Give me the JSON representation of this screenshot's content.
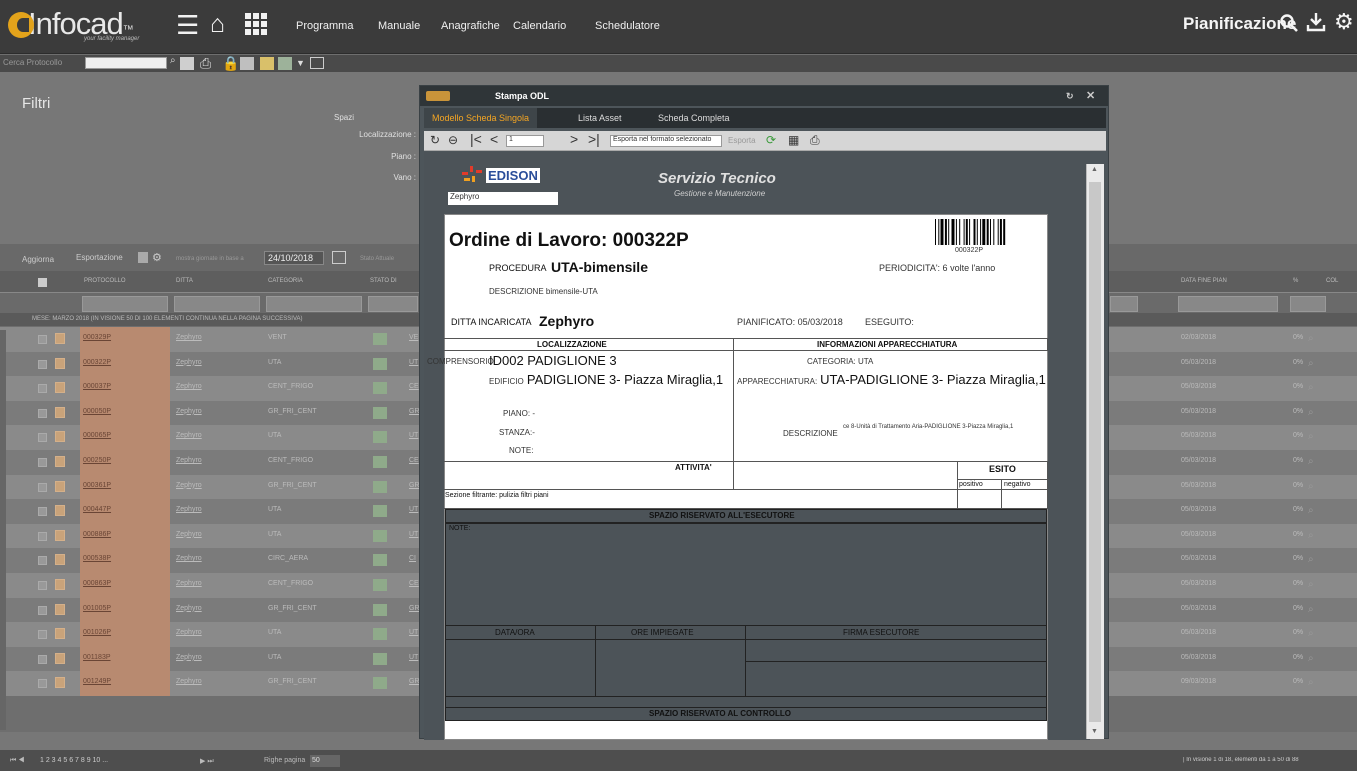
{
  "app": {
    "brand": "Infocad",
    "brand_mark": "™",
    "brand_sub": "your facility manager",
    "section": "Pianificazione"
  },
  "nav": [
    "Programma",
    "Manuale",
    "Anagrafiche",
    "Calendario",
    "Schedulatore"
  ],
  "bar2": {
    "label": "Cerca Protocollo",
    "placeholder": ""
  },
  "filters": {
    "title": "Filtri",
    "spazi": "Spazi",
    "labels": [
      "Localizzazione :",
      "Piano :",
      "Vano :"
    ]
  },
  "gridbar": {
    "aggiorna": "Aggiorna",
    "esportazione": "Esportazione",
    "date_label": "mostra giornate in base a",
    "date_value": "24/10/2018",
    "stato": "Stato Attuale"
  },
  "grid": {
    "headers": [
      "PROTOCOLLO",
      "DITTA",
      "CATEGORIA",
      "STATO DI",
      "DATA FINE PIAN",
      "%",
      "COL"
    ],
    "group": "MESE: MARZO 2018 (IN VISIONE 50 DI 100 ELEMENTI CONTINUA NELLA PAGINA SUCCESSIVA)"
  },
  "rows": [
    {
      "protocollo": "000329P",
      "ditta": "Zephyro",
      "categoria": "VENT",
      "code": "VE",
      "data": "02/03/2018",
      "pct": "0%"
    },
    {
      "protocollo": "000322P",
      "ditta": "Zephyro",
      "categoria": "UTA",
      "code": "UT",
      "data": "05/03/2018",
      "pct": "0%"
    },
    {
      "protocollo": "000037P",
      "ditta": "Zephyro",
      "categoria": "CENT_FRIGO",
      "code": "CE",
      "data": "05/03/2018",
      "pct": "0%"
    },
    {
      "protocollo": "000050P",
      "ditta": "Zephyro",
      "categoria": "GR_FRI_CENT",
      "code": "GR",
      "data": "05/03/2018",
      "pct": "0%"
    },
    {
      "protocollo": "000065P",
      "ditta": "Zephyro",
      "categoria": "UTA",
      "code": "UT",
      "data": "05/03/2018",
      "pct": "0%"
    },
    {
      "protocollo": "000250P",
      "ditta": "Zephyro",
      "categoria": "CENT_FRIGO",
      "code": "CE",
      "data": "05/03/2018",
      "pct": "0%"
    },
    {
      "protocollo": "000361P",
      "ditta": "Zephyro",
      "categoria": "GR_FRI_CENT",
      "code": "GR",
      "data": "05/03/2018",
      "pct": "0%"
    },
    {
      "protocollo": "000447P",
      "ditta": "Zephyro",
      "categoria": "UTA",
      "code": "UT",
      "data": "05/03/2018",
      "pct": "0%"
    },
    {
      "protocollo": "000886P",
      "ditta": "Zephyro",
      "categoria": "UTA",
      "code": "UT",
      "data": "05/03/2018",
      "pct": "0%"
    },
    {
      "protocollo": "000538P",
      "ditta": "Zephyro",
      "categoria": "CIRC_AERA",
      "code": "CI",
      "data": "05/03/2018",
      "pct": "0%"
    },
    {
      "protocollo": "000863P",
      "ditta": "Zephyro",
      "categoria": "CENT_FRIGO",
      "code": "CE",
      "data": "05/03/2018",
      "pct": "0%"
    },
    {
      "protocollo": "001005P",
      "ditta": "Zephyro",
      "categoria": "GR_FRI_CENT",
      "code": "GR",
      "data": "05/03/2018",
      "pct": "0%"
    },
    {
      "protocollo": "001026P",
      "ditta": "Zephyro",
      "categoria": "UTA",
      "code": "UT",
      "data": "05/03/2018",
      "pct": "0%"
    },
    {
      "protocollo": "001183P",
      "ditta": "Zephyro",
      "categoria": "UTA",
      "code": "UT",
      "data": "05/03/2018",
      "pct": "0%"
    },
    {
      "protocollo": "001249P",
      "ditta": "Zephyro",
      "categoria": "GR_FRI_CENT",
      "code": "GR",
      "data": "09/03/2018",
      "pct": "0%"
    }
  ],
  "footer": {
    "pages": "1 2 3 4 5 6 7 8 9 10 ...",
    "righe": "Righe pagina",
    "righe_val": "50",
    "status": "| In visione 1 di 18, elementi da 1 a 50 di 88"
  },
  "modal": {
    "title": "Stampa ODL",
    "tabs": [
      "Modello Scheda Singola",
      "Lista Asset",
      "Scheda Completa"
    ],
    "page": "1",
    "export_select": "Esporta nel formato selezionato",
    "export_btn": "Esporta",
    "doc": {
      "logo": "EDISON",
      "logo_sub": "Zephyro",
      "serv_title": "Servizio Tecnico",
      "serv_sub": "Gestione e Manutenzione",
      "odl_title": "Ordine di Lavoro: 000322P",
      "barcode_num": "000322P",
      "procedura_l": "PROCEDURA",
      "procedura_v": "UTA-bimensile",
      "periodicita": "PERIODICITA': 6 volte l'anno",
      "descr": "DESCRIZIONE bimensile-UTA",
      "ditta_l": "DITTA INCARICATA",
      "ditta_v": "Zephyro",
      "pianificato": "PIANIFICATO: 05/03/2018",
      "eseguito": "ESEGUITO:",
      "loc_h": "LOCALIZZAZIONE",
      "app_h": "INFORMAZIONI APPARECCHIATURA",
      "compr_l": "COMPRENSORIO",
      "compr_v": "ID002 PADIGLIONE 3",
      "edif_l": "EDIFICIO",
      "edif_v": "PADIGLIONE 3- Piazza Miraglia,1",
      "piano": "PIANO: -",
      "stanza": "STANZA:-",
      "note": "NOTE:",
      "cat": "CATEGORIA: UTA",
      "appar_l": "APPARECCHIATURA:",
      "appar_v": "UTA-PADIGLIONE 3- Piazza Miraglia,1",
      "descr_l": "DESCRIZIONE",
      "descr_v": "ce 8-Unità di Trattamento Aria-PADIGLIONE 3-Piazza Miraglia,1",
      "attivita": "ATTIVITA'",
      "esito": "ESITO",
      "positivo": "positivo",
      "negativo": "negativo",
      "sezione": "Sezione filtrante: pulizia filtri piani",
      "spazio_es": "SPAZIO RISERVATO ALL'ESECUTORE",
      "note2": "NOTE:",
      "dataora": "DATA/ORA",
      "ore": "ORE IMPIEGATE",
      "firma": "FIRMA ESECUTORE",
      "spazio_ctrl": "SPAZIO RISERVATO AL CONTROLLO"
    }
  }
}
